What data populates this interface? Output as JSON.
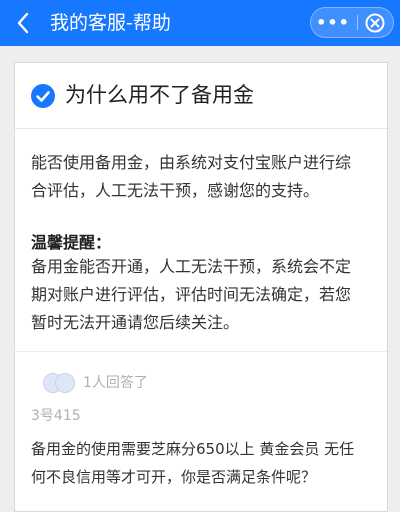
{
  "header": {
    "title": "我的客服-帮助",
    "more_label": "•••"
  },
  "question": {
    "title": "为什么用不了备用金"
  },
  "answer": {
    "line1": "能否使用备用金，由系统对支付宝账户进行综",
    "line2": "合评估，人工无法干预，感谢您的支持。",
    "tip_title": "温馨提醒：",
    "tip_line1": "备用金能否开通，人工无法干预，系统会不定",
    "tip_line2": "期对账户进行评估，评估时间无法确定，若您",
    "tip_line3": "暂时无法开通请您后续关注。"
  },
  "replies": {
    "count_text": "1人回答了",
    "user": "3号415",
    "text_line1": "备用金的使用需要芝麻分650以上 黄金会员 无任",
    "text_line2": "何不良信用等才可开，你是否满足条件呢？"
  },
  "colors": {
    "header_bg": "#1677ff",
    "check": "#1677ff"
  },
  "icons": {
    "back": "chevron-left-icon",
    "more": "more-dots-icon",
    "close": "close-circle-icon",
    "check": "check-circle-icon"
  }
}
